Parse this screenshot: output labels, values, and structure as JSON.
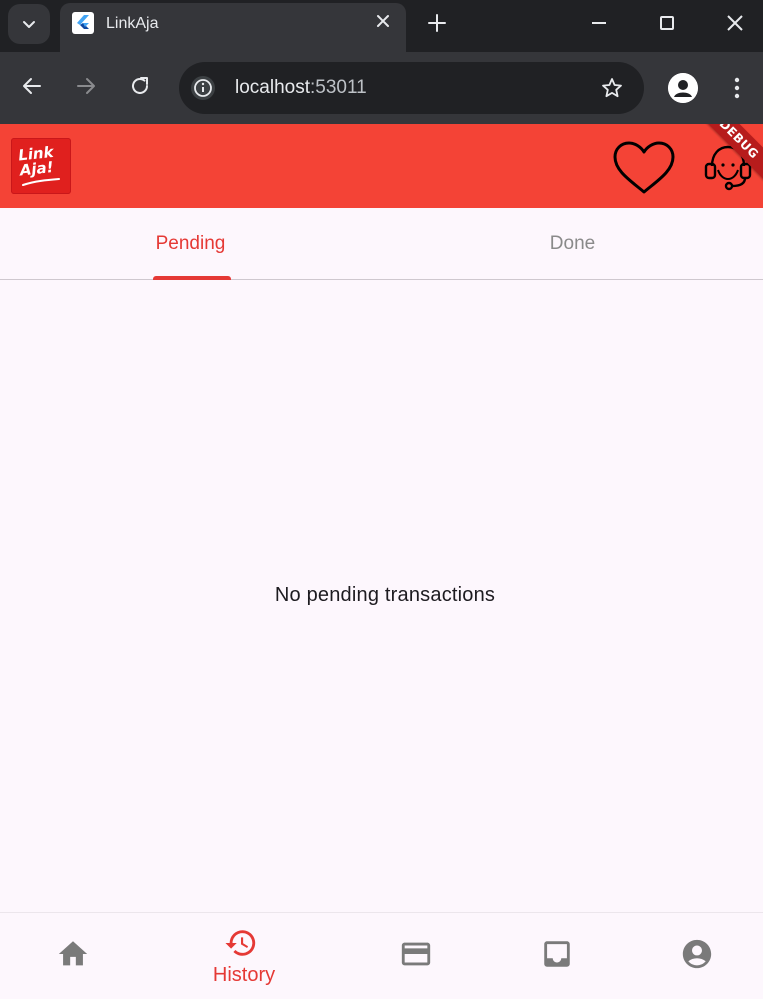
{
  "browser": {
    "tab_title": "LinkAja",
    "url_host": "localhost",
    "url_port": ":53011"
  },
  "app": {
    "logo_text_line1": "Link",
    "logo_text_line2": "Aja!",
    "debug_banner": "DEBUG",
    "tabs": [
      {
        "label": "Pending",
        "selected": true
      },
      {
        "label": "Done",
        "selected": false
      }
    ],
    "empty_message": "No pending transactions",
    "bottom_nav": [
      {
        "icon": "home-icon",
        "label": "",
        "selected": false
      },
      {
        "icon": "history-icon",
        "label": "History",
        "selected": true
      },
      {
        "icon": "card-icon",
        "label": "",
        "selected": false
      },
      {
        "icon": "inbox-icon",
        "label": "",
        "selected": false
      },
      {
        "icon": "account-circle-icon",
        "label": "",
        "selected": false
      }
    ],
    "colors": {
      "appbar": "#f44336",
      "accent": "#e53935",
      "background": "#fdf7fd",
      "inactive": "#8a8a8a"
    }
  }
}
